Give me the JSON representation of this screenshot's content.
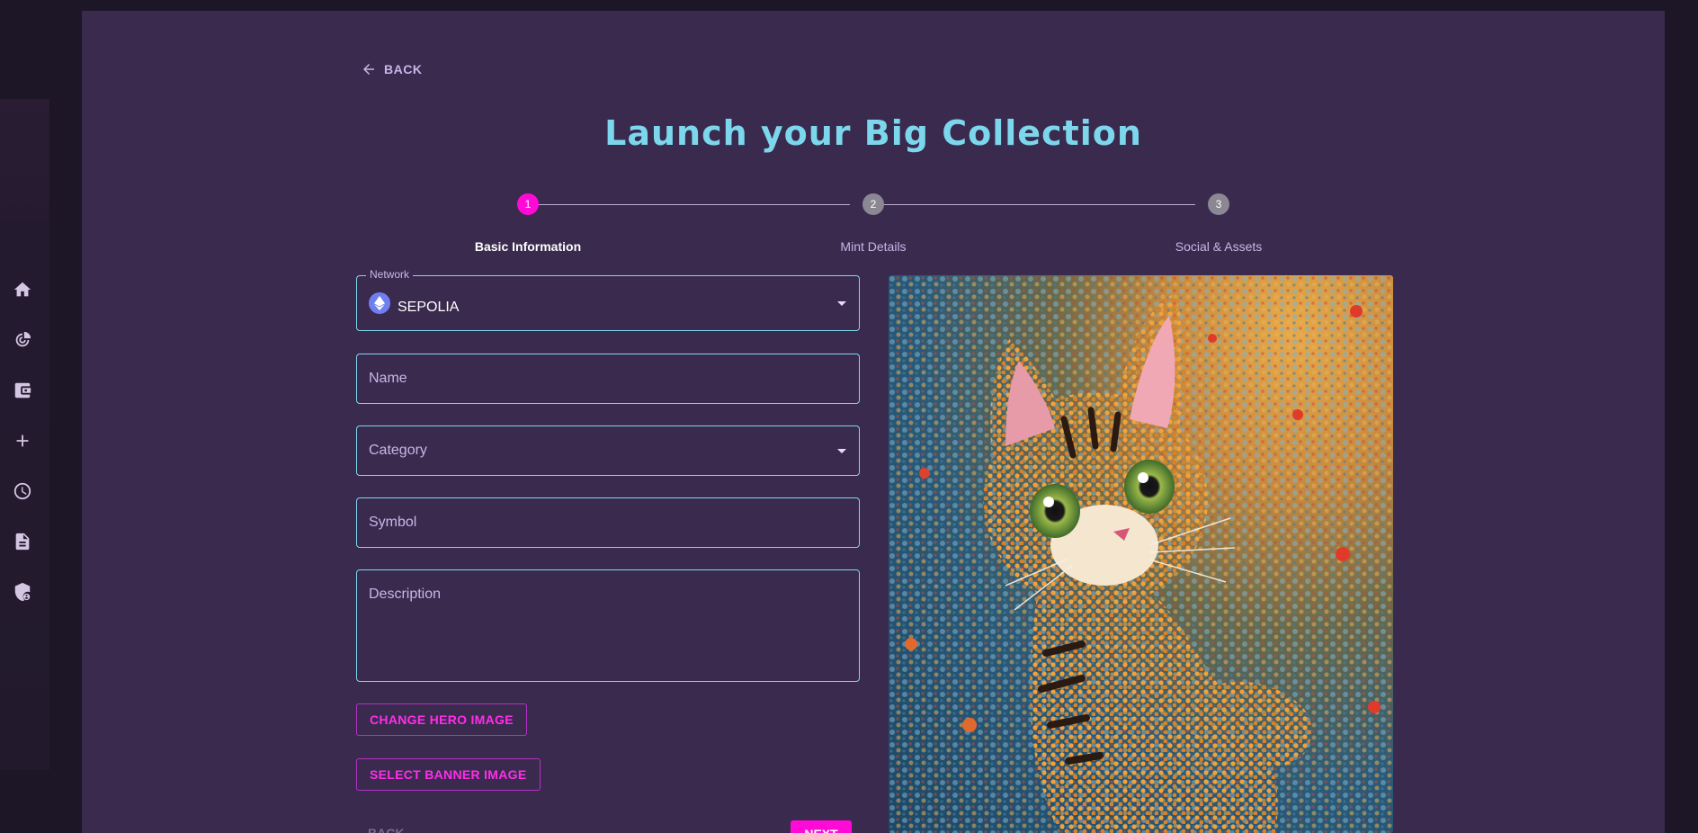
{
  "sidebar": {
    "icons": [
      "home-icon",
      "stats-icon",
      "wallet-icon",
      "add-icon",
      "history-icon",
      "document-icon",
      "security-icon"
    ]
  },
  "page": {
    "back_label": "BACK",
    "title": "Launch your Big Collection"
  },
  "stepper": {
    "steps": [
      {
        "number": "1",
        "label": "Basic Information",
        "active": true
      },
      {
        "number": "2",
        "label": "Mint Details",
        "active": false
      },
      {
        "number": "3",
        "label": "Social & Assets",
        "active": false
      }
    ]
  },
  "form": {
    "network": {
      "legend": "Network",
      "value": "SEPOLIA",
      "icon": "ethereum-icon"
    },
    "name": {
      "placeholder": "Name"
    },
    "category": {
      "placeholder": "Category"
    },
    "symbol": {
      "placeholder": "Symbol"
    },
    "description": {
      "placeholder": "Description"
    },
    "change_hero_label": "CHANGE HERO IMAGE",
    "select_banner_label": "SELECT BANNER IMAGE",
    "back_button_label": "BACK",
    "next_button_label": "NEXT"
  },
  "colors": {
    "accent": "#ff0ad6",
    "title": "#7dd7ec",
    "field_border": "#7dd7ec",
    "panel_bg": "#3a2a4e"
  }
}
